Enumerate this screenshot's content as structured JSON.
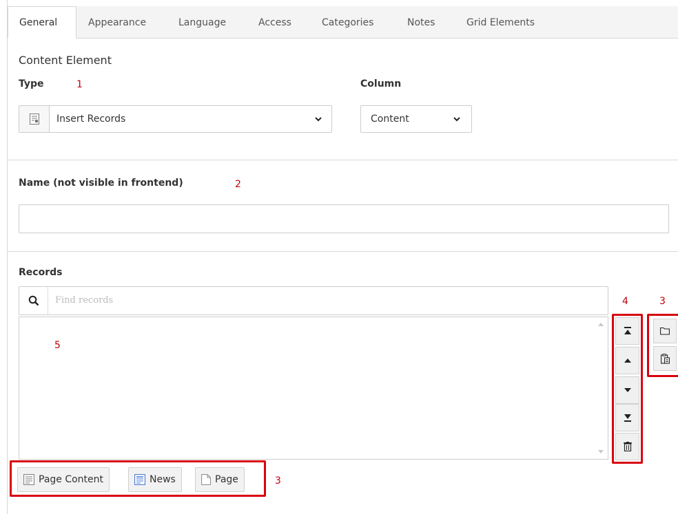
{
  "tabs": [
    "General",
    "Appearance",
    "Language",
    "Access",
    "Categories",
    "Notes",
    "Grid Elements"
  ],
  "section": {
    "title": "Content Element"
  },
  "type_field": {
    "label": "Type",
    "marker": "1",
    "value": "Insert Records",
    "icon": "content-element-icon"
  },
  "column_field": {
    "label": "Column",
    "value": "Content"
  },
  "name_field": {
    "label": "Name (not visible in frontend)",
    "marker": "2",
    "value": ""
  },
  "records": {
    "label": "Records",
    "search_placeholder": "Find records",
    "list_marker": "5",
    "controls_marker": "4",
    "side_marker": "3",
    "buttons_marker": "3",
    "controls": [
      "move-top-icon",
      "move-up-icon",
      "move-down-icon",
      "move-bottom-icon",
      "trash-icon"
    ],
    "side_actions": [
      "folder-icon",
      "clipboard-icon"
    ],
    "add_buttons": [
      "Page Content",
      "News",
      "Page"
    ]
  },
  "colors": {
    "accent": "#d9000d",
    "marker": "#c0000b",
    "border": "#cccccc"
  }
}
